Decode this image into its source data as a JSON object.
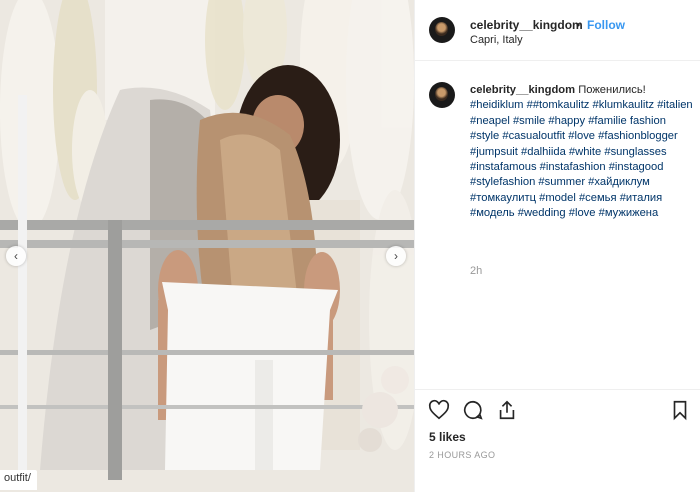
{
  "photo": {
    "caption_fragment": "outfit/",
    "left_arrow": "‹",
    "right_arrow": "›"
  },
  "header": {
    "username": "celebrity__kingdom",
    "separator": "•",
    "follow_label": "Follow",
    "location": "Capri, Italy"
  },
  "caption": {
    "username": "celebrity__kingdom",
    "text": "Поженились!",
    "hashtags": [
      "#heidiklum",
      "##tomkaulitz",
      "#klumkaulitz",
      "#italien",
      "#neapel",
      "#smile",
      "#happy",
      "#familie",
      "fashion",
      "#style",
      "#casualoutfit",
      "#love",
      "#fashionblogger",
      "#jumpsuit",
      "#dalhiida",
      "#white",
      "#sunglasses",
      "#instafamous",
      "#instafashion",
      "#instagood",
      "#stylefashion",
      "#summer",
      "#хайдиклум",
      "#томкаулитц",
      "#model",
      "#семья",
      "#италия",
      "#модель",
      "#wedding",
      "#love",
      "#мужижена"
    ],
    "time": "2h"
  },
  "actions": {
    "likes": "5 likes",
    "time_ago": "2 HOURS AGO"
  },
  "icons": [
    "heart-icon",
    "comment-icon",
    "share-icon",
    "bookmark-icon"
  ]
}
